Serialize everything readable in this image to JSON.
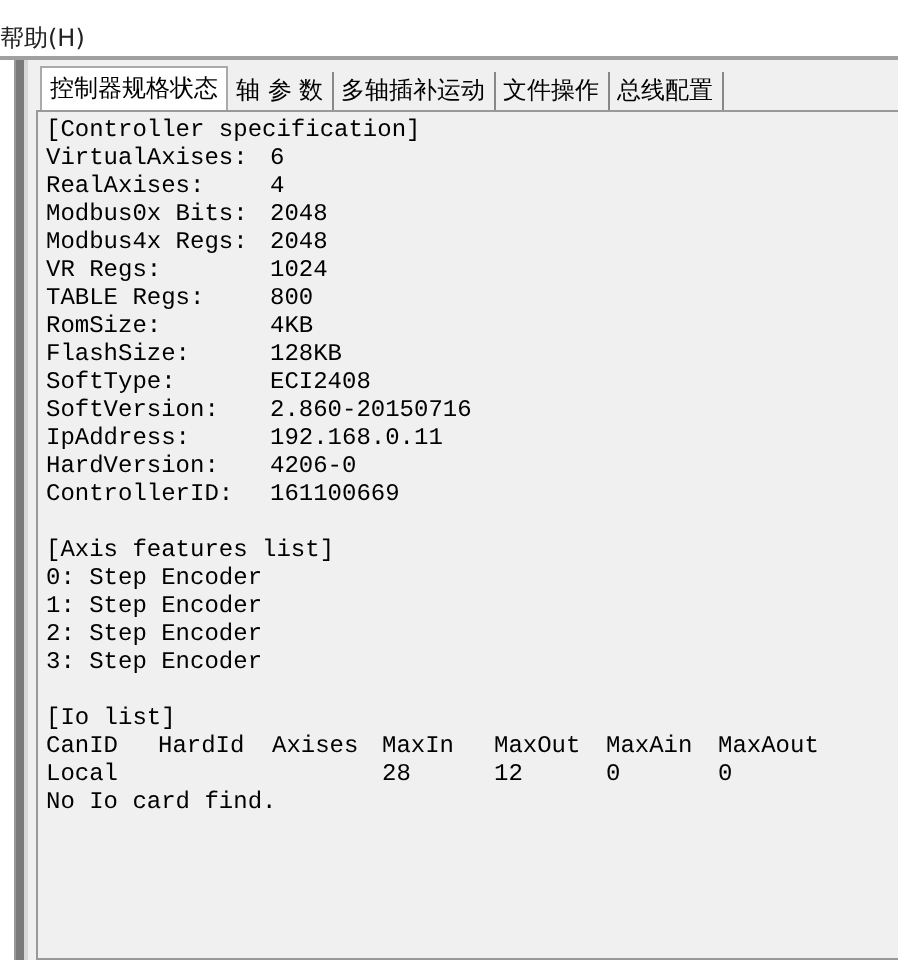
{
  "menu": [
    {
      "label": "帮助(H)"
    }
  ],
  "tabs": [
    {
      "label": "控制器规格状态",
      "selected": true
    },
    {
      "label": "轴 参 数",
      "selected": false
    },
    {
      "label": "多轴插补运动",
      "selected": false
    },
    {
      "label": "文件操作",
      "selected": false
    },
    {
      "label": "总线配置",
      "selected": false
    }
  ],
  "spec": {
    "title": "[Controller specification]",
    "rows": [
      {
        "label": "VirtualAxises:",
        "value": "6"
      },
      {
        "label": "RealAxises:",
        "value": "4"
      },
      {
        "label": "Modbus0x Bits:",
        "value": "2048"
      },
      {
        "label": "Modbus4x Regs:",
        "value": "2048"
      },
      {
        "label": "VR Regs:",
        "value": "1024"
      },
      {
        "label": "TABLE Regs:",
        "value": "800"
      },
      {
        "label": "RomSize:",
        "value": "4KB"
      },
      {
        "label": "FlashSize:",
        "value": "128KB"
      },
      {
        "label": "SoftType:",
        "value": "ECI2408"
      },
      {
        "label": "SoftVersion:",
        "value": "2.860-20150716"
      },
      {
        "label": "IpAddress:",
        "value": "192.168.0.11"
      },
      {
        "label": "HardVersion:",
        "value": "4206-0"
      },
      {
        "label": "ControllerID:",
        "value": "161100669"
      }
    ]
  },
  "axes": {
    "title": "[Axis features list]",
    "lines": [
      "0: Step Encoder",
      "1: Step Encoder",
      "2: Step Encoder",
      "3: Step Encoder"
    ]
  },
  "io": {
    "title": "[Io list]",
    "columns": [
      "CanID",
      "HardId",
      "Axises",
      "MaxIn",
      "MaxOut",
      "MaxAin",
      "MaxAout"
    ],
    "rows": [
      [
        "Local",
        "",
        "",
        "28",
        "12",
        "0",
        "0"
      ]
    ],
    "note": "No Io card find."
  }
}
